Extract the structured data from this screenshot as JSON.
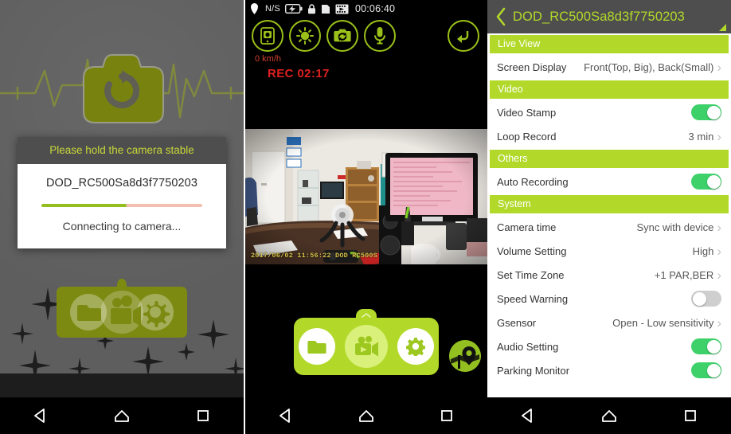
{
  "panels": {
    "connect": {
      "name": "Connecting screen",
      "hero_icon": "camera-refresh-icon",
      "dialog": {
        "title": "Please hold the camera stable",
        "device_name": "DOD_RC500Sa8d3f7750203",
        "status": "Connecting to camera...",
        "progress_percent": 53
      },
      "dock": {
        "items": [
          {
            "icon": "folder-icon",
            "label": "Files"
          },
          {
            "icon": "video-camera-icon",
            "label": "Live View"
          },
          {
            "icon": "gear-icon",
            "label": "Settings"
          }
        ]
      }
    },
    "live": {
      "name": "Live view screen",
      "statusbar": {
        "gps_label": "N/S",
        "gps_icon": "location-pin-icon",
        "battery_icon": "battery-charging-icon",
        "lock_icon": "lock-icon",
        "sdcard_icon": "sd-card-icon",
        "filmstrip_icon": "filmstrip-icon",
        "time": "00:06:40"
      },
      "controls": [
        {
          "icon": "phone-snapshot-icon",
          "label": "Snapshot to phone"
        },
        {
          "icon": "brightness-icon",
          "label": "Brightness"
        },
        {
          "icon": "camera-switch-icon",
          "label": "Switch camera"
        },
        {
          "icon": "microphone-icon",
          "label": "Microphone"
        }
      ],
      "back_button": {
        "icon": "back-arrow-icon",
        "label": "Back"
      },
      "speed": "0 km/h",
      "recording": "REC 02:17",
      "video_stamp": "2017/06/02 11:56:22 DOD RC500S",
      "dock": {
        "handle_icon": "chevron-up-icon",
        "items": [
          {
            "icon": "folder-icon",
            "label": "Files",
            "active": false
          },
          {
            "icon": "video-camera-icon",
            "label": "Live View",
            "active": true
          },
          {
            "icon": "gear-icon",
            "label": "Settings",
            "active": false
          }
        ]
      },
      "gps_badge": {
        "icon": "map-pin-icon",
        "label": "GPS"
      }
    },
    "settings": {
      "name": "Settings screen",
      "header": {
        "back_icon": "chevron-left-icon",
        "title": "DOD_RC500Sa8d3f7750203",
        "corner_icon": "signal-triangle-icon"
      },
      "sections": [
        {
          "title": "Live View",
          "rows": [
            {
              "label": "Screen Display",
              "type": "value",
              "value": "Front(Top, Big), Back(Small)",
              "chevron": "›"
            }
          ]
        },
        {
          "title": "Video",
          "rows": [
            {
              "label": "Video Stamp",
              "type": "toggle",
              "value": "on"
            },
            {
              "label": "Loop Record",
              "type": "value",
              "value": "3 min",
              "chevron": "›"
            }
          ]
        },
        {
          "title": "Others",
          "rows": [
            {
              "label": "Auto Recording",
              "type": "toggle",
              "value": "on"
            }
          ]
        },
        {
          "title": "System",
          "rows": [
            {
              "label": "Camera time",
              "type": "value",
              "value": "Sync with device",
              "chevron": "›"
            },
            {
              "label": "Volume Setting",
              "type": "value",
              "value": "High",
              "chevron": "›"
            },
            {
              "label": "Set Time Zone",
              "type": "value",
              "value": "+1 PAR,BER",
              "chevron": "›"
            },
            {
              "label": "Speed Warning",
              "type": "toggle",
              "value": "off"
            },
            {
              "label": "Gsensor",
              "type": "value",
              "value": "Open - Low sensitivity",
              "chevron": "›"
            },
            {
              "label": "Audio Setting",
              "type": "toggle",
              "value": "on"
            },
            {
              "label": "Parking Monitor",
              "type": "toggle",
              "value": "on"
            }
          ]
        }
      ]
    }
  },
  "navbar": {
    "back": "back-triangle-icon",
    "home": "home-icon",
    "recents": "recents-square-icon"
  },
  "colors": {
    "brand_green": "#b2d92a",
    "olive": "#7d8a12",
    "toggle_on": "#3ed16a",
    "toggle_off": "#cfcfcf",
    "progress_fill": "#93c020",
    "progress_track": "#f3bfb0",
    "rec_red": "#e02020",
    "panel_gray": "#5e5e5e",
    "header_gray": "#4e4e4e"
  }
}
